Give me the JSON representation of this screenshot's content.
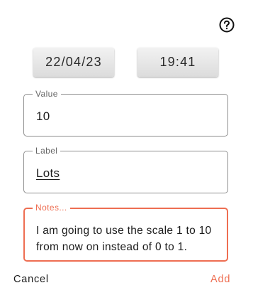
{
  "header": {
    "help_icon": "help-circle-icon"
  },
  "pickers": {
    "date_value": "22/04/23",
    "time_value": "19:41"
  },
  "fields": {
    "value": {
      "legend": "Value",
      "text": "10"
    },
    "label": {
      "legend": "Label",
      "text": "Lots"
    },
    "notes": {
      "legend": "Notes...",
      "text": "I am going to use the scale 1 to 10 from now on instead of 0 to 1."
    }
  },
  "actions": {
    "cancel_label": "Cancel",
    "add_label": "Add"
  },
  "colors": {
    "accent": "#ee6e52",
    "text": "#1c1c1c",
    "border": "#8f8f8f"
  }
}
